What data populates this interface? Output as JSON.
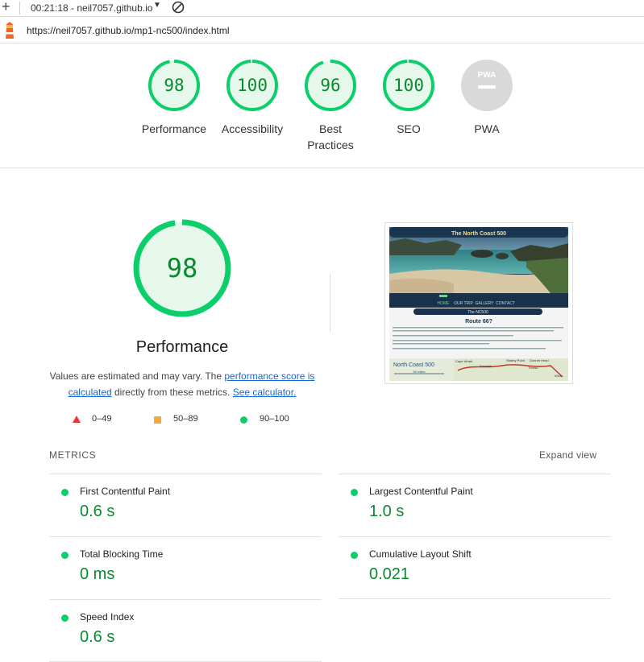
{
  "toolbar": {
    "session": "00:21:18 - neil7057.github.io",
    "plus_icon": "plus-icon",
    "caret_icon": "caret-down-icon",
    "block_icon": "block-icon"
  },
  "address": {
    "url": "https://neil7057.github.io/mp1-nc500/index.html",
    "icon": "lighthouse-icon"
  },
  "summary": [
    {
      "score": "98",
      "label": "Performance"
    },
    {
      "score": "100",
      "label": "Accessibility"
    },
    {
      "score": "96",
      "label_line1": "Best",
      "label_line2": "Practices"
    },
    {
      "score": "100",
      "label": "SEO"
    },
    {
      "score": "PWA",
      "label": "PWA"
    }
  ],
  "performance": {
    "score": "98",
    "title": "Performance",
    "desc_1": "Values are estimated and may vary. The ",
    "desc_link1": "performance score is calculated",
    "desc_2": " directly from these metrics. ",
    "desc_link2": "See calculator."
  },
  "legend": {
    "fail": "0–49",
    "average": "50–89",
    "pass": "90–100"
  },
  "screenshot": {
    "site_title": "The North Coast 500",
    "nav": [
      "HOME",
      "OUR TRIP",
      "GALLERY",
      "CONTACT"
    ],
    "section": "The NC500",
    "heading": "Route 66?",
    "map_title": "North Coast 500",
    "map_scale": "50 miles",
    "map_places": [
      "Cape Wrath",
      "Durness",
      "Strathy Point",
      "Dunnet Head",
      "Thurso",
      "Wick"
    ]
  },
  "metrics": {
    "header": "METRICS",
    "expand": "Expand view",
    "items": [
      {
        "label": "First Contentful Paint",
        "value": "0.6 s"
      },
      {
        "label": "Largest Contentful Paint",
        "value": "1.0 s"
      },
      {
        "label": "Total Blocking Time",
        "value": "0 ms"
      },
      {
        "label": "Cumulative Layout Shift",
        "value": "0.021"
      },
      {
        "label": "Speed Index",
        "value": "0.6 s"
      }
    ]
  },
  "colors": {
    "pass": "#0cce6b",
    "pass_text": "#0a8a2f",
    "pass_bg": "#e6f7ec",
    "average": "#f4a938",
    "fail": "#e33",
    "link": "#1967d2",
    "pwa_gray": "#d9d9d9"
  },
  "scores_fraction": {
    "performance": 0.98,
    "accessibility": 1.0,
    "best_practices": 0.96,
    "seo": 1.0
  }
}
